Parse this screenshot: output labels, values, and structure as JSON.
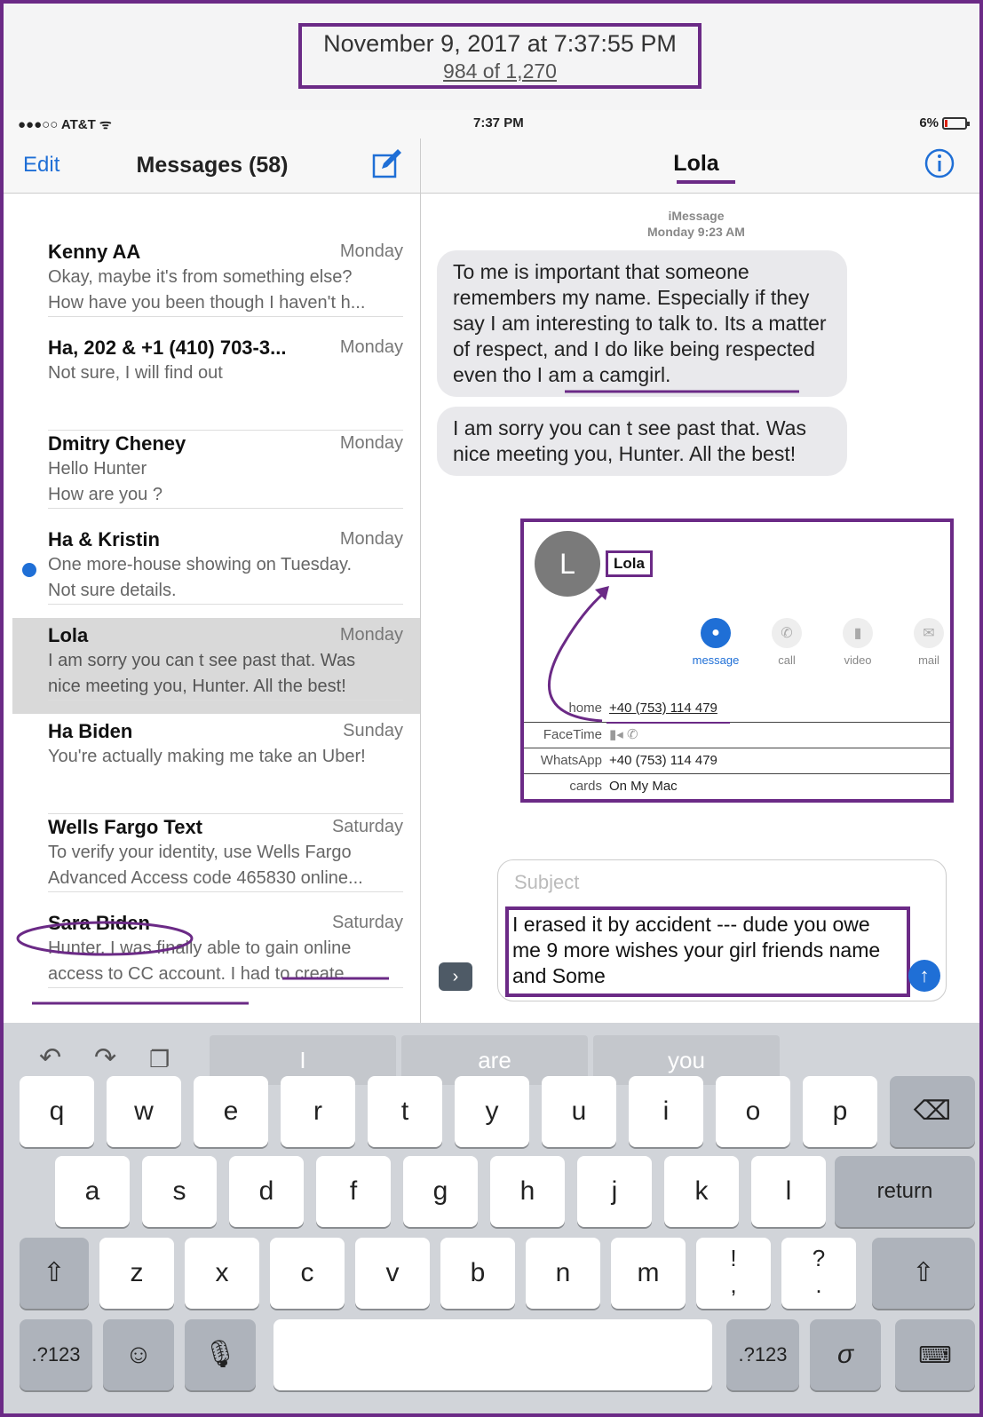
{
  "header": {
    "date": "November 9, 2017 at 7:37:55 PM",
    "count": "984 of 1,270"
  },
  "status_bar": {
    "carrier": "●●●○○ AT&T ᯤ",
    "time": "7:37 PM",
    "battery": "6%"
  },
  "messages_list": {
    "edit_label": "Edit",
    "title": "Messages (58)",
    "conversations": [
      {
        "name": "Kenny AA",
        "date": "Monday",
        "line1": "Okay, maybe it's from something else?",
        "line2": "How have you been though I haven't h..."
      },
      {
        "name": "Ha, 202 & +1 (410) 703-3...",
        "date": "Monday",
        "line1": "Not sure, I will find out",
        "line2": ""
      },
      {
        "name": "Dmitry Cheney",
        "date": "Monday",
        "line1": "Hello Hunter",
        "line2": "How are you ?"
      },
      {
        "name": "Ha & Kristin",
        "date": "Monday",
        "line1": "One more-house showing on Tuesday.",
        "line2": "Not sure details."
      },
      {
        "name": "Lola",
        "date": "Monday",
        "line1": "I am sorry you can t see past that. Was",
        "line2": "nice meeting you, Hunter. All the best!"
      },
      {
        "name": "Ha Biden",
        "date": "Sunday",
        "line1": "You're actually making me take an Uber!",
        "line2": ""
      },
      {
        "name": "Wells Fargo Text",
        "date": "Saturday",
        "line1": "To verify your identity, use Wells Fargo",
        "line2": "Advanced Access code 465830 online..."
      },
      {
        "name": "Sara Biden",
        "date": "Saturday",
        "line1": "Hunter, I was finally able to gain online",
        "line2": "access to CC account. I had to create..."
      }
    ]
  },
  "conversation": {
    "title": "Lola",
    "service": "iMessage",
    "timestamp": "Monday 9:23 AM",
    "bubbles": [
      "To me is important that someone remembers my name. Especially if they say I am interesting to talk to. Its a matter of respect, and I do like being respected even tho I am a camgirl.",
      "I am sorry you can t see past that. Was nice meeting you, Hunter. All the best!"
    ],
    "contact_card": {
      "initial": "L",
      "name": "Lola",
      "actions": [
        "message",
        "call",
        "video",
        "mail"
      ],
      "fields": [
        {
          "label": "home",
          "value": "+40 (753) 114 479"
        },
        {
          "label": "FaceTime",
          "value": "▮◂ ✆"
        },
        {
          "label": "WhatsApp",
          "value": "+40 (753) 114 479"
        },
        {
          "label": "cards",
          "value": "On My Mac"
        }
      ]
    },
    "subject_placeholder": "Subject",
    "typed_text": "I erased it by accident --- dude you owe me 9 more wishes your girl friends name and Some"
  },
  "keyboard": {
    "suggestions": [
      "I",
      "are",
      "you"
    ],
    "row1": [
      "q",
      "w",
      "e",
      "r",
      "t",
      "y",
      "u",
      "i",
      "o",
      "p"
    ],
    "row2": [
      "a",
      "s",
      "d",
      "f",
      "g",
      "h",
      "j",
      "k",
      "l"
    ],
    "row3": [
      "z",
      "x",
      "c",
      "v",
      "b",
      "n",
      "m",
      "!\n,",
      "?\n."
    ],
    "return_label": "return",
    "numbers_label": ".?123",
    "icons": {
      "undo": "undo-icon",
      "redo": "redo-icon",
      "paste": "paste-icon",
      "backspace": "backspace-icon",
      "shift": "shift-icon",
      "emoji": "emoji-icon",
      "mic": "microphone-icon",
      "scribble": "scribble-icon",
      "hide": "keyboard-dismiss-icon"
    }
  },
  "colors": {
    "annotation": "#6b2a86",
    "accent": "#1f6fd6"
  }
}
